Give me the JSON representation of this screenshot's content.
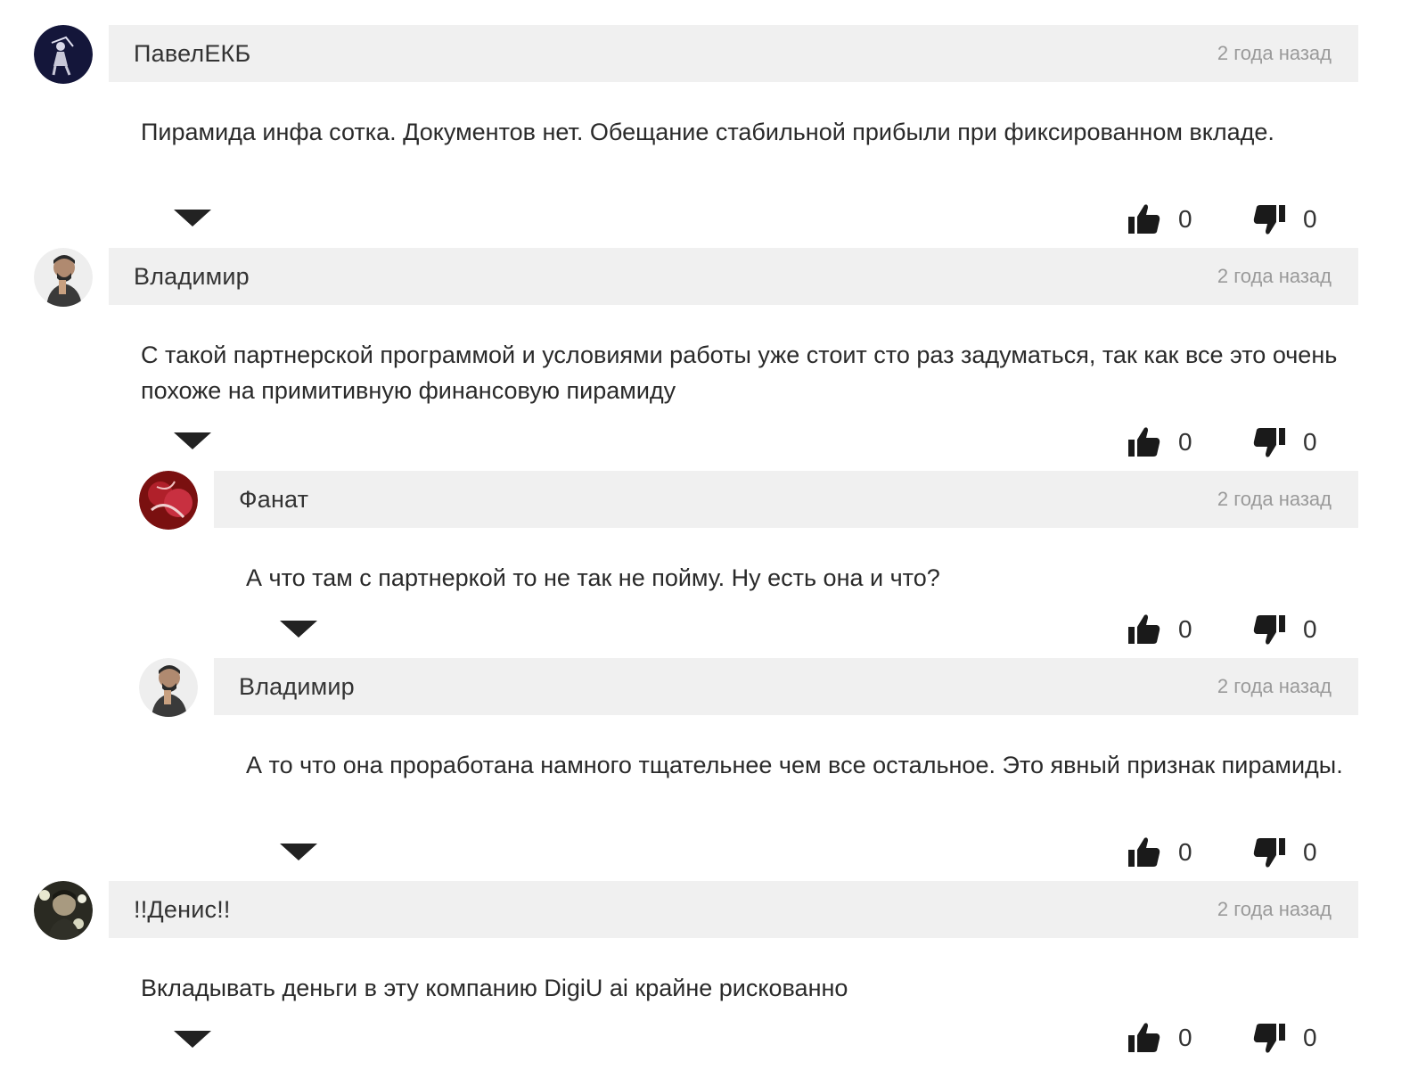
{
  "comments": [
    {
      "author": "ПавелЕКБ",
      "time": "2 года назад",
      "text": "Пирамида инфа сотка. Документов нет. Обещание стабильной прибыли при фиксированном вкладе.",
      "likes": "0",
      "dislikes": "0",
      "avatar_icon": "avatar-dark-figure-icon"
    },
    {
      "author": "Владимир",
      "time": "2 года назад",
      "text": "С такой партнерской программой и условиями работы уже стоит сто раз задуматься, так как все это очень похоже на примитивную финансовую пирамиду",
      "likes": "0",
      "dislikes": "0",
      "avatar_icon": "avatar-man-portrait-icon"
    },
    {
      "author": "Фанат",
      "time": "2 года назад",
      "text": "А что там с партнеркой то не так не пойму. Ну есть она и что?",
      "likes": "0",
      "dislikes": "0",
      "avatar_icon": "avatar-red-abstract-icon"
    },
    {
      "author": "Владимир",
      "time": "2 года назад",
      "text": "А то что она проработана намного тщательнее чем все остальное. Это явный признак пирамиды.",
      "likes": "0",
      "dislikes": "0",
      "avatar_icon": "avatar-man-portrait-icon"
    },
    {
      "author": "!!Денис!!",
      "time": "2 года назад",
      "text": "Вкладывать деньги в эту компанию DigiU ai крайне рискованно",
      "likes": "0",
      "dislikes": "0",
      "avatar_icon": "avatar-man-flowers-icon"
    }
  ],
  "colors": {
    "header_bg": "#f0f0f0",
    "time_text": "#9a9a9a",
    "icon": "#1a1a1a"
  }
}
